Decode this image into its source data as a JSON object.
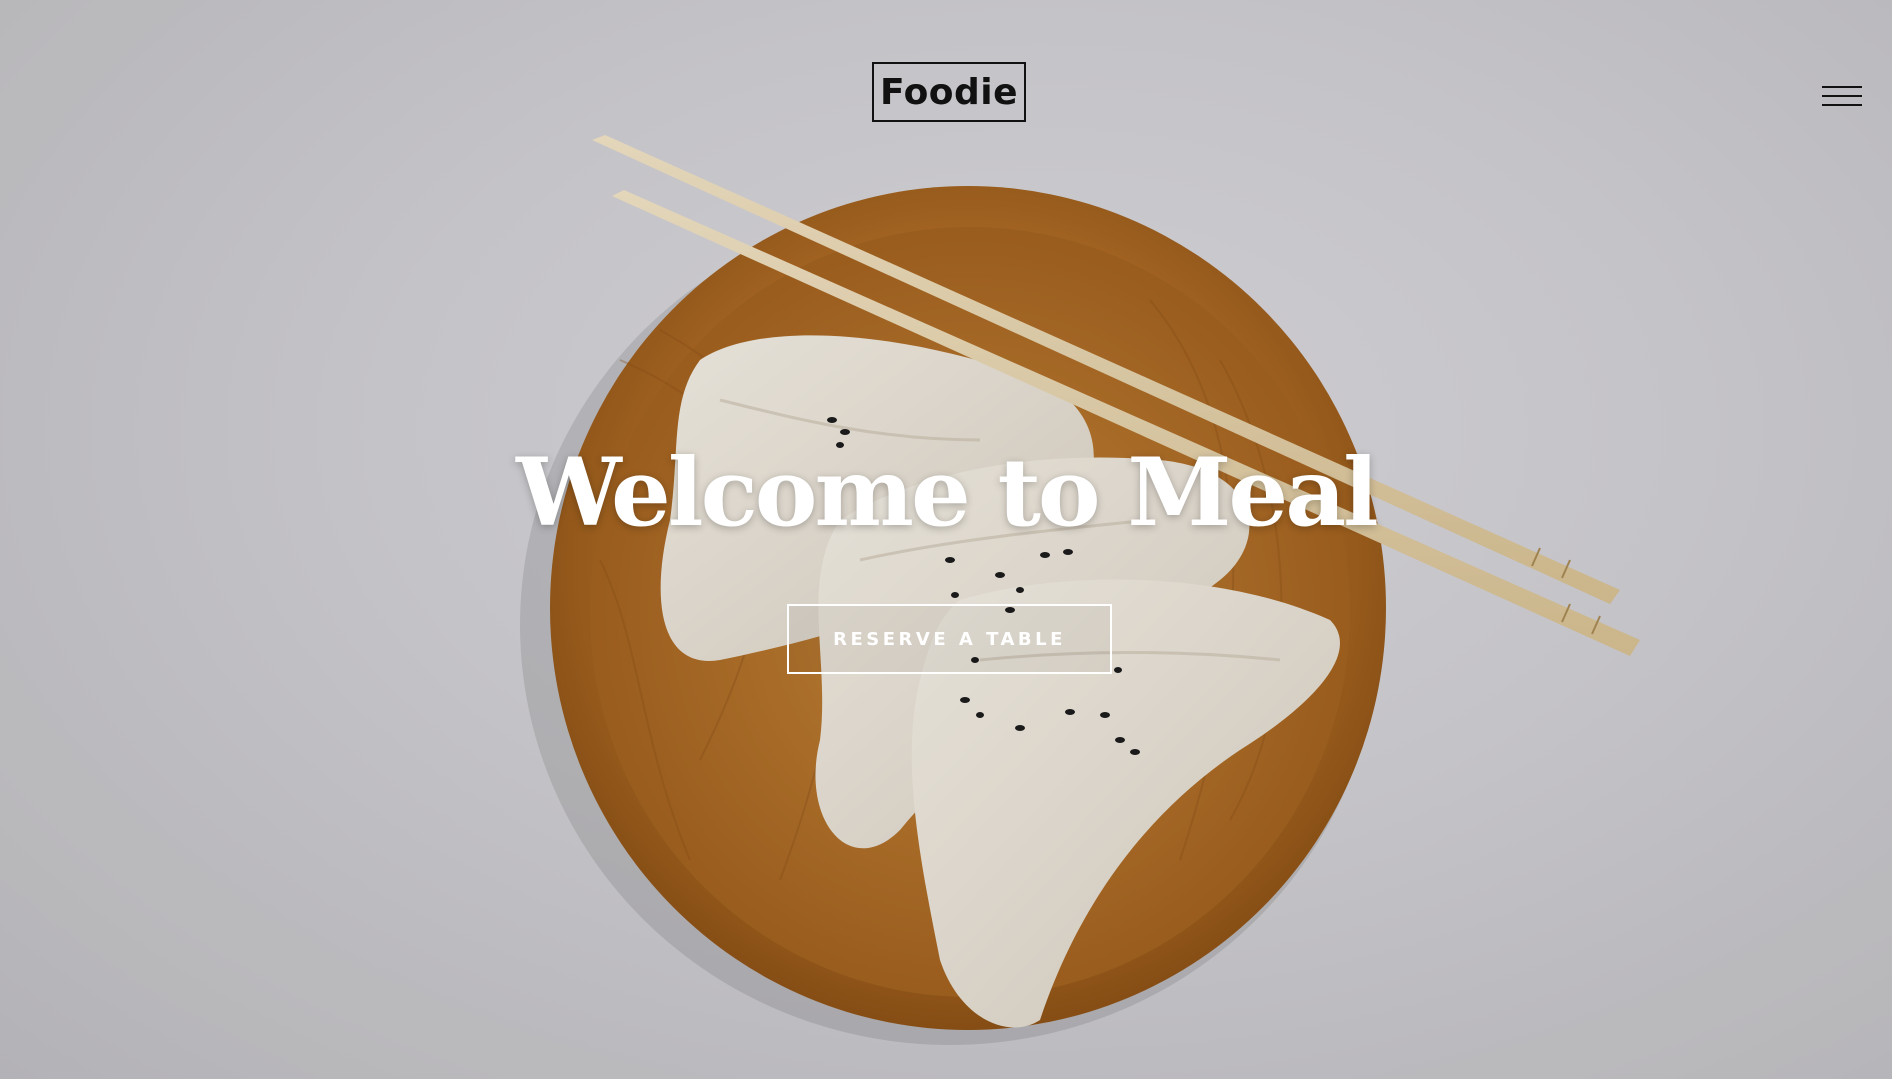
{
  "header": {
    "logo_text": "Foodie",
    "menu_icon": "hamburger-menu-icon"
  },
  "hero": {
    "title": "Welcome to Meal",
    "cta_label": "RESERVE A TABLE",
    "photo": "dumplings-on-wooden-plate-with-chopsticks"
  },
  "colors": {
    "background": "#cfced2",
    "text_dark": "#111111",
    "text_light": "#ffffff",
    "plate_wood": "#b8732a"
  }
}
